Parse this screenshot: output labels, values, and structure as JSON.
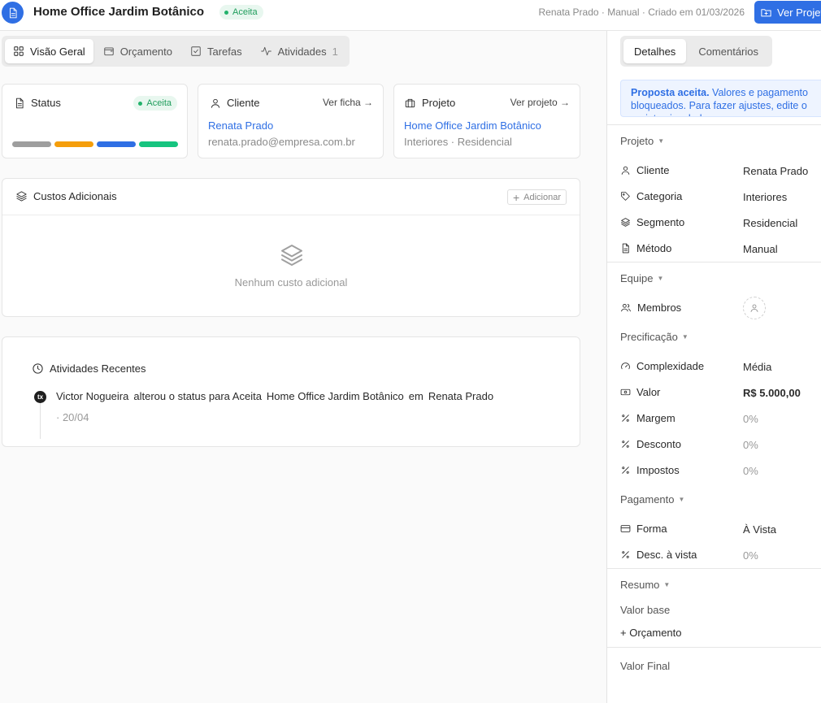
{
  "header": {
    "title": "Home Office Jardim Botânico",
    "status": "Aceita",
    "meta": "Renata Prado · Manual · Criado em 01/03/2026",
    "primary_button": "Ver Projeto"
  },
  "tabs": [
    {
      "label": "Visão Geral",
      "icon": "grid-icon"
    },
    {
      "label": "Orçamento",
      "icon": "wallet-icon"
    },
    {
      "label": "Tarefas",
      "icon": "checkbox-icon"
    },
    {
      "label": "Atividades",
      "icon": "activity-icon",
      "count": "1"
    }
  ],
  "status_card": {
    "title": "Status",
    "badge": "Aceita",
    "bar_colors": [
      "#9e9e9e",
      "#f59e0b",
      "#2f6fe4",
      "#16c47f"
    ]
  },
  "client_card": {
    "title": "Cliente",
    "link": "Ver ficha →",
    "name": "Renata Prado",
    "email": "renata.prado@empresa.com.br"
  },
  "project_card": {
    "title": "Projeto",
    "link": "Ver projeto →",
    "name": "Home Office Jardim Botânico",
    "sub": "Interiores · Residencial"
  },
  "costs_card": {
    "title": "Custos Adicionais",
    "add_label": "Adicionar",
    "empty": "Nenhum custo adicional"
  },
  "activity_card": {
    "title": "Atividades Recentes",
    "avatar": "tx",
    "actor": "Victor Nogueira",
    "action": "alterou o status para Aceita",
    "target": "Home Office Jardim Botânico",
    "preposition": "em",
    "place": "Renata Prado",
    "date": "· 20/04"
  },
  "panel": {
    "tabs": [
      "Detalhes",
      "Comentários"
    ],
    "notice_bold": "Proposta aceita.",
    "notice_text": " Valores e pagamento bloqueados. Para fazer ajustes, edite o projeto vinculado.",
    "sections": {
      "projeto": "Projeto",
      "equipe": "Equipe",
      "precificacao": "Precificação",
      "pagamento": "Pagamento",
      "resumo": "Resumo"
    },
    "rows": {
      "cliente": {
        "label": "Cliente",
        "value": "Renata Prado"
      },
      "categoria": {
        "label": "Categoria",
        "value": "Interiores"
      },
      "segmento": {
        "label": "Segmento",
        "value": "Residencial"
      },
      "metodo": {
        "label": "Método",
        "value": "Manual"
      },
      "membros": {
        "label": "Membros"
      },
      "complexidade": {
        "label": "Complexidade",
        "value": "Média"
      },
      "valor": {
        "label": "Valor",
        "value": "R$ 5.000,00"
      },
      "margem": {
        "label": "Margem",
        "value": "0%"
      },
      "desconto": {
        "label": "Desconto",
        "value": "0%"
      },
      "impostos": {
        "label": "Impostos",
        "value": "0%"
      },
      "forma": {
        "label": "Forma",
        "value": "À Vista"
      },
      "desc_vista": {
        "label": "Desc. à vista",
        "value": "0%"
      }
    },
    "summary": {
      "base": "Valor base",
      "orcamento": "+ Orçamento",
      "final": "Valor Final"
    }
  }
}
